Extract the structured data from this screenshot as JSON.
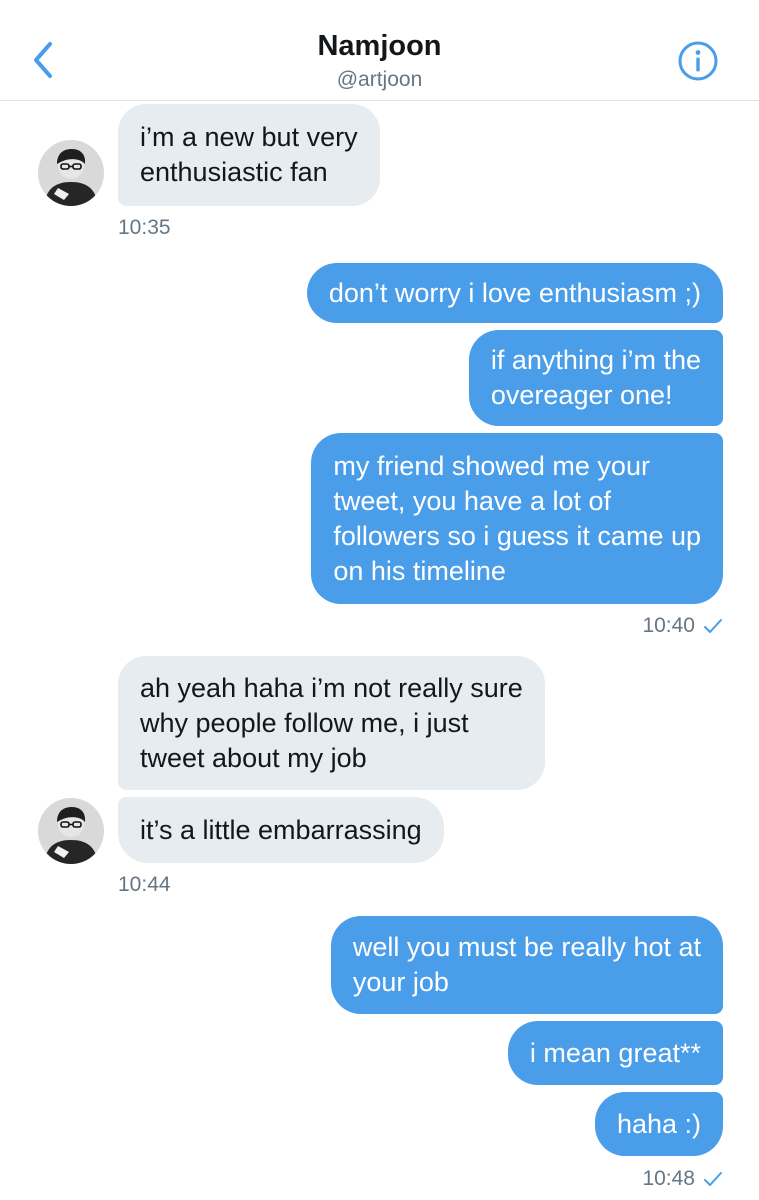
{
  "header": {
    "name": "Namjoon",
    "handle": "@artjoon",
    "back_icon": "chevron-left-icon",
    "info_icon": "info-icon"
  },
  "colors": {
    "accent": "#4a9de9",
    "incoming_bubble": "#e6ecf0",
    "secondary_text": "#657786"
  },
  "messages": [
    {
      "from": "them",
      "lines": [
        "i’m a new but very",
        "enthusiastic fan"
      ]
    },
    {
      "from": "me",
      "lines": [
        "don’t worry i love enthusiasm ;)"
      ]
    },
    {
      "from": "me",
      "lines": [
        "if anything i’m the",
        "overeager one!"
      ]
    },
    {
      "from": "me",
      "lines": [
        "my friend showed me your",
        "tweet, you have a lot of",
        "followers so i guess it came up",
        "on his timeline"
      ]
    },
    {
      "from": "them",
      "lines": [
        "ah yeah haha i’m not really sure",
        "why people follow me, i just",
        "tweet about my job"
      ]
    },
    {
      "from": "them",
      "lines": [
        "it’s a little embarrassing"
      ]
    },
    {
      "from": "me",
      "lines": [
        "well you must be really hot at",
        "your job"
      ]
    },
    {
      "from": "me",
      "lines": [
        "i mean great**"
      ]
    },
    {
      "from": "me",
      "lines": [
        "haha :)"
      ]
    }
  ],
  "timestamps": [
    "10:35",
    "10:40",
    "10:44",
    "10:48"
  ]
}
